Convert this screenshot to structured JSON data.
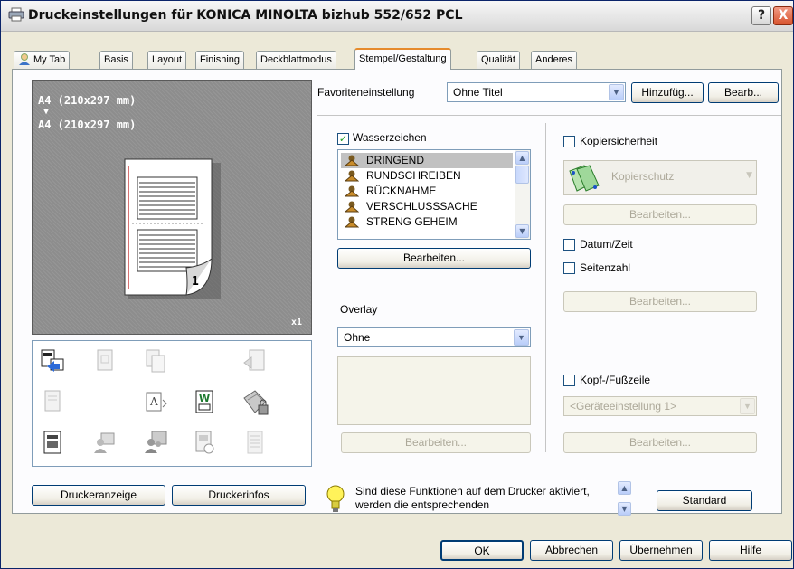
{
  "window": {
    "title": "Druckeinstellungen für KONICA MINOLTA bizhub 552/652 PCL",
    "help_label": "?",
    "close_label": "X"
  },
  "tabs": [
    {
      "label": "My Tab",
      "active": false
    },
    {
      "label": "Basis",
      "active": false
    },
    {
      "label": "Layout",
      "active": false
    },
    {
      "label": "Finishing",
      "active": false
    },
    {
      "label": "Deckblattmodus",
      "active": false
    },
    {
      "label": "Stempel/Gestaltung",
      "active": true
    },
    {
      "label": "Qualität",
      "active": false
    },
    {
      "label": "Anderes",
      "active": false
    }
  ],
  "preview": {
    "source_size": "A4 (210x297 mm)",
    "arrow": "▼",
    "output_size": "A4 (210x297 mm)",
    "page_number": "1",
    "copies": "x1"
  },
  "left_buttons": {
    "printer_view": "Druckeranzeige",
    "printer_info": "Druckerinfos"
  },
  "favorites": {
    "label": "Favoriteneinstellung",
    "value": "Ohne Titel",
    "add_button": "Hinzufüg...",
    "edit_button": "Bearb..."
  },
  "watermark": {
    "checkbox_label": "Wasserzeichen",
    "checked": true,
    "items": [
      "DRINGEND",
      "RUNDSCHREIBEN",
      "RÜCKNAHME",
      "VERSCHLUSSSACHE",
      "STRENG GEHEIM"
    ],
    "selected_index": 0,
    "edit_button": "Bearbeiten..."
  },
  "overlay": {
    "label": "Overlay",
    "value": "Ohne",
    "edit_button": "Bearbeiten..."
  },
  "copy_security": {
    "checkbox_label": "Kopiersicherheit",
    "checked": false,
    "combo_value": "Kopierschutz",
    "edit_button": "Bearbeiten..."
  },
  "date_time": {
    "checkbox_label": "Datum/Zeit",
    "checked": false
  },
  "page_number": {
    "checkbox_label": "Seitenzahl",
    "checked": false,
    "edit_button": "Bearbeiten..."
  },
  "header_footer": {
    "checkbox_label": "Kopf-/Fußzeile",
    "checked": false,
    "combo_value": "<Geräteeinstellung 1>",
    "edit_button": "Bearbeiten..."
  },
  "info": {
    "text_line1": "Sind diese Funktionen auf dem Drucker aktiviert,",
    "text_line2": "werden die entsprechenden",
    "standard_button": "Standard"
  },
  "footer_buttons": {
    "ok": "OK",
    "cancel": "Abbrechen",
    "apply": "Übernehmen",
    "help": "Hilfe"
  },
  "colors": {
    "tab_accent": "#e68b2c",
    "xp_blue_border": "#003c74",
    "close_red": "#d8542f"
  }
}
